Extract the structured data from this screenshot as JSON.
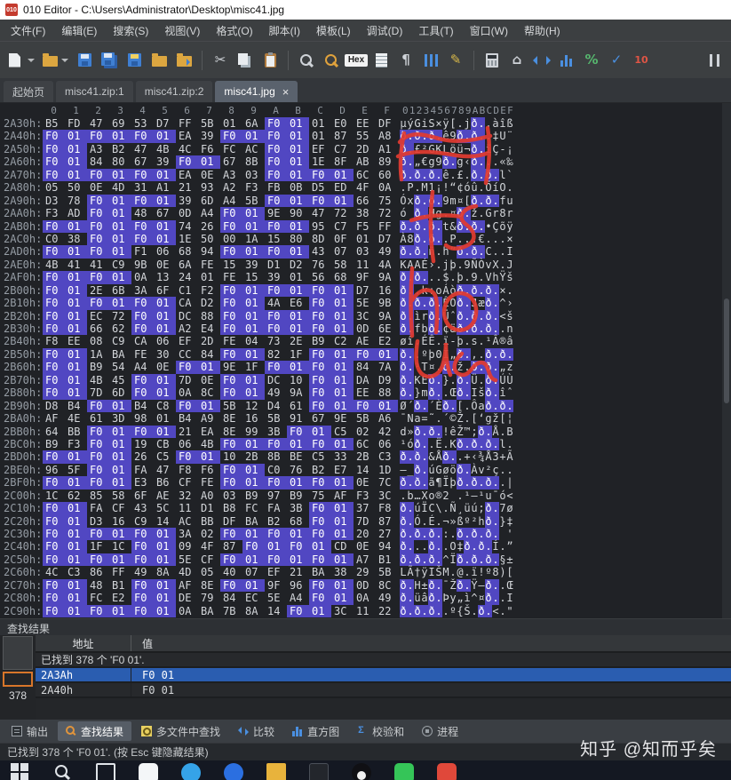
{
  "window": {
    "title": "010 Editor - C:\\Users\\Administrator\\Desktop\\misc41.jpg",
    "app_icon": "010-red-square"
  },
  "menu": {
    "items": [
      {
        "id": "file",
        "label": "文件(F)"
      },
      {
        "id": "edit",
        "label": "编辑(E)"
      },
      {
        "id": "search",
        "label": "搜索(S)"
      },
      {
        "id": "view",
        "label": "视图(V)"
      },
      {
        "id": "format",
        "label": "格式(O)"
      },
      {
        "id": "script",
        "label": "脚本(I)"
      },
      {
        "id": "template",
        "label": "模板(L)"
      },
      {
        "id": "debug",
        "label": "调试(D)"
      },
      {
        "id": "tools",
        "label": "工具(T)"
      },
      {
        "id": "window",
        "label": "窗口(W)"
      },
      {
        "id": "help",
        "label": "帮助(H)"
      }
    ]
  },
  "toolbar": {
    "buttons": [
      {
        "name": "new-file",
        "kind": "css",
        "css": "page",
        "caret": true
      },
      {
        "name": "open-file",
        "kind": "css",
        "css": "folder",
        "caret": true
      },
      {
        "name": "save",
        "kind": "css",
        "css": "floppy"
      },
      {
        "name": "save-all",
        "kind": "css",
        "css": "floppy2"
      },
      {
        "name": "save-as",
        "kind": "css",
        "css": "floppy3"
      },
      {
        "name": "close-file",
        "kind": "css",
        "css": "folder2"
      },
      {
        "name": "export-file",
        "kind": "css",
        "css": "folder3"
      },
      {
        "kind": "sep"
      },
      {
        "name": "cut",
        "kind": "glyph",
        "glyph": "✂",
        "color": "#cfd3d8"
      },
      {
        "name": "copy",
        "kind": "css",
        "css": "copy"
      },
      {
        "name": "paste",
        "kind": "css",
        "css": "clipboard"
      },
      {
        "kind": "sep"
      },
      {
        "name": "find",
        "kind": "css",
        "css": "magnifier"
      },
      {
        "name": "replace",
        "kind": "css",
        "css": "magnifier2"
      },
      {
        "name": "hex-view",
        "kind": "hexbox",
        "label": "Hex"
      },
      {
        "name": "text-view",
        "kind": "css",
        "css": "pagelines"
      },
      {
        "name": "show-whitespace",
        "kind": "glyph",
        "glyph": "¶",
        "color": "#cfd3d8"
      },
      {
        "name": "column-mode",
        "kind": "css",
        "css": "columns"
      },
      {
        "name": "run-script",
        "kind": "glyph",
        "glyph": "✎",
        "color": "#d8b84a"
      },
      {
        "kind": "sep"
      },
      {
        "name": "calculator",
        "kind": "css",
        "css": "calc"
      },
      {
        "name": "base-converter",
        "kind": "glyph",
        "glyph": "⌂",
        "color": "#cfd3d8"
      },
      {
        "name": "jump-arrows",
        "kind": "css",
        "css": "arrows"
      },
      {
        "name": "histogram",
        "kind": "css",
        "css": "bars"
      },
      {
        "name": "checksum",
        "kind": "glyph",
        "glyph": "%",
        "color": "#56b66e"
      },
      {
        "name": "validate",
        "kind": "glyph",
        "glyph": "✓",
        "color": "#4a8fe0"
      },
      {
        "name": "convert-base-10",
        "kind": "glyph",
        "glyph": "10",
        "color": "#e05545"
      },
      {
        "kind": "spacer"
      },
      {
        "name": "pause",
        "kind": "css",
        "css": "pause"
      }
    ]
  },
  "tabs": {
    "items": [
      {
        "id": "start-page",
        "label": "起始页",
        "active": false
      },
      {
        "id": "misc41-zip-1",
        "label": "misc41.zip:1",
        "active": false
      },
      {
        "id": "misc41-zip-2",
        "label": "misc41.zip:2",
        "active": false
      },
      {
        "id": "misc41-jpg",
        "label": "misc41.jpg",
        "active": true,
        "close": "×"
      }
    ]
  },
  "hex": {
    "byte_headers": [
      "0",
      "1",
      "2",
      "3",
      "4",
      "5",
      "6",
      "7",
      "8",
      "9",
      "A",
      "B",
      "C",
      "D",
      "E",
      "F"
    ],
    "ascii_header": "0123456789ABCDEF",
    "rows": [
      {
        "addr": "2A30h:",
        "bytes": [
          "B5",
          "FD",
          "47",
          "69",
          "53",
          "D7",
          "FF",
          "5B",
          "01",
          "6A",
          "F0",
          "01",
          "01",
          "E0",
          "EE",
          "DF"
        ]
      },
      {
        "addr": "2A40h:",
        "bytes": [
          "F0",
          "01",
          "F0",
          "01",
          "F0",
          "01",
          "EA",
          "39",
          "F0",
          "01",
          "F0",
          "01",
          "01",
          "87",
          "55",
          "A8"
        ]
      },
      {
        "addr": "2A50h:",
        "bytes": [
          "F0",
          "01",
          "A3",
          "B2",
          "47",
          "4B",
          "4C",
          "F6",
          "FC",
          "AC",
          "F0",
          "01",
          "EF",
          "C7",
          "2D",
          "A1"
        ]
      },
      {
        "addr": "2A60h:",
        "bytes": [
          "F0",
          "01",
          "84",
          "80",
          "67",
          "39",
          "F0",
          "01",
          "67",
          "8B",
          "F0",
          "01",
          "1E",
          "8F",
          "AB",
          "89"
        ]
      },
      {
        "addr": "2A70h:",
        "bytes": [
          "F0",
          "01",
          "F0",
          "01",
          "F0",
          "01",
          "EA",
          "0E",
          "A3",
          "03",
          "F0",
          "01",
          "F0",
          "01",
          "6C",
          "60"
        ]
      },
      {
        "addr": "2A80h:",
        "bytes": [
          "05",
          "50",
          "0E",
          "4D",
          "31",
          "A1",
          "21",
          "93",
          "A2",
          "F3",
          "FB",
          "0B",
          "D5",
          "ED",
          "4F",
          "0A"
        ]
      },
      {
        "addr": "2A90h:",
        "bytes": [
          "D3",
          "78",
          "F0",
          "01",
          "F0",
          "01",
          "39",
          "6D",
          "A4",
          "5B",
          "F0",
          "01",
          "F0",
          "01",
          "66",
          "75"
        ]
      },
      {
        "addr": "2AA0h:",
        "bytes": [
          "F3",
          "AD",
          "F0",
          "01",
          "48",
          "67",
          "0D",
          "A4",
          "F0",
          "01",
          "9E",
          "90",
          "47",
          "72",
          "38",
          "72"
        ]
      },
      {
        "addr": "2AB0h:",
        "bytes": [
          "F0",
          "01",
          "F0",
          "01",
          "F0",
          "01",
          "74",
          "26",
          "F0",
          "01",
          "F0",
          "01",
          "95",
          "C7",
          "F5",
          "FF"
        ]
      },
      {
        "addr": "2AC0h:",
        "bytes": [
          "C0",
          "38",
          "F0",
          "01",
          "F0",
          "01",
          "1E",
          "50",
          "00",
          "1A",
          "15",
          "80",
          "8D",
          "0F",
          "01",
          "D7"
        ]
      },
      {
        "addr": "2AD0h:",
        "bytes": [
          "F0",
          "01",
          "F0",
          "01",
          "F1",
          "06",
          "68",
          "94",
          "F0",
          "01",
          "F0",
          "01",
          "43",
          "07",
          "03",
          "49"
        ]
      },
      {
        "addr": "2AE0h:",
        "bytes": [
          "4B",
          "41",
          "41",
          "C9",
          "9B",
          "0E",
          "6A",
          "FE",
          "15",
          "39",
          "D1",
          "D2",
          "76",
          "58",
          "11",
          "4A"
        ]
      },
      {
        "addr": "2AF0h:",
        "bytes": [
          "F0",
          "01",
          "F0",
          "01",
          "0A",
          "13",
          "24",
          "01",
          "FE",
          "15",
          "39",
          "01",
          "56",
          "68",
          "9F",
          "9A"
        ]
      },
      {
        "addr": "2B00h:",
        "bytes": [
          "F0",
          "01",
          "2E",
          "6B",
          "3A",
          "6F",
          "C1",
          "F2",
          "F0",
          "01",
          "F0",
          "01",
          "F0",
          "01",
          "D7",
          "16"
        ]
      },
      {
        "addr": "2B10h:",
        "bytes": [
          "F0",
          "01",
          "F0",
          "01",
          "F0",
          "01",
          "CA",
          "D2",
          "F0",
          "01",
          "4A",
          "E6",
          "F0",
          "01",
          "5E",
          "9B"
        ]
      },
      {
        "addr": "2B20h:",
        "bytes": [
          "F0",
          "01",
          "EC",
          "72",
          "F0",
          "01",
          "DC",
          "88",
          "F0",
          "01",
          "F0",
          "01",
          "F0",
          "01",
          "3C",
          "9A"
        ]
      },
      {
        "addr": "2B30h:",
        "bytes": [
          "F0",
          "01",
          "66",
          "62",
          "F0",
          "01",
          "A2",
          "E4",
          "F0",
          "01",
          "F0",
          "01",
          "F0",
          "01",
          "0D",
          "6E"
        ]
      },
      {
        "addr": "2B40h:",
        "bytes": [
          "F8",
          "EE",
          "08",
          "C9",
          "CA",
          "06",
          "EF",
          "2D",
          "FE",
          "04",
          "73",
          "2E",
          "B9",
          "C2",
          "AE",
          "E2"
        ]
      },
      {
        "addr": "2B50h:",
        "bytes": [
          "F0",
          "01",
          "1A",
          "BA",
          "FE",
          "30",
          "CC",
          "84",
          "F0",
          "01",
          "82",
          "1F",
          "F0",
          "01",
          "F0",
          "01"
        ]
      },
      {
        "addr": "2B60h:",
        "bytes": [
          "F0",
          "01",
          "B9",
          "54",
          "A4",
          "0E",
          "F0",
          "01",
          "9E",
          "1F",
          "F0",
          "01",
          "F0",
          "01",
          "84",
          "7A"
        ]
      },
      {
        "addr": "2B70h:",
        "bytes": [
          "F0",
          "01",
          "4B",
          "45",
          "F0",
          "01",
          "7D",
          "0E",
          "F0",
          "01",
          "DC",
          "10",
          "F0",
          "01",
          "DA",
          "D9"
        ]
      },
      {
        "addr": "2B80h:",
        "bytes": [
          "F0",
          "01",
          "7D",
          "6D",
          "F0",
          "01",
          "0A",
          "8C",
          "F0",
          "01",
          "49",
          "9A",
          "F0",
          "01",
          "EE",
          "88"
        ]
      },
      {
        "addr": "2B90h:",
        "bytes": [
          "D8",
          "B4",
          "F0",
          "01",
          "B4",
          "C8",
          "F0",
          "01",
          "5B",
          "12",
          "D4",
          "61",
          "F0",
          "01",
          "F0",
          "01"
        ]
      },
      {
        "addr": "2BA0h:",
        "bytes": [
          "AF",
          "4E",
          "61",
          "3D",
          "98",
          "01",
          "B4",
          "A9",
          "8E",
          "16",
          "5B",
          "91",
          "67",
          "9E",
          "5B",
          "A6"
        ]
      },
      {
        "addr": "2BB0h:",
        "bytes": [
          "64",
          "BB",
          "F0",
          "01",
          "F0",
          "01",
          "21",
          "EA",
          "8E",
          "99",
          "3B",
          "F0",
          "01",
          "C5",
          "02",
          "42"
        ]
      },
      {
        "addr": "2BC0h:",
        "bytes": [
          "B9",
          "F3",
          "F0",
          "01",
          "19",
          "CB",
          "06",
          "4B",
          "F0",
          "01",
          "F0",
          "01",
          "F0",
          "01",
          "6C",
          "06"
        ]
      },
      {
        "addr": "2BD0h:",
        "bytes": [
          "F0",
          "01",
          "F0",
          "01",
          "26",
          "C5",
          "F0",
          "01",
          "10",
          "2B",
          "8B",
          "BE",
          "C5",
          "33",
          "2B",
          "C3"
        ]
      },
      {
        "addr": "2BE0h:",
        "bytes": [
          "96",
          "5F",
          "F0",
          "01",
          "FA",
          "47",
          "F8",
          "F6",
          "F0",
          "01",
          "C0",
          "76",
          "B2",
          "E7",
          "14",
          "1D"
        ]
      },
      {
        "addr": "2BF0h:",
        "bytes": [
          "F0",
          "01",
          "F0",
          "01",
          "E3",
          "B6",
          "CF",
          "FE",
          "F0",
          "01",
          "F0",
          "01",
          "F0",
          "01",
          "0E",
          "7C"
        ]
      },
      {
        "addr": "2C00h:",
        "bytes": [
          "1C",
          "62",
          "85",
          "58",
          "6F",
          "AE",
          "32",
          "A0",
          "03",
          "B9",
          "97",
          "B9",
          "75",
          "AF",
          "F3",
          "3C"
        ]
      },
      {
        "addr": "2C10h:",
        "bytes": [
          "F0",
          "01",
          "FA",
          "CF",
          "43",
          "5C",
          "11",
          "D1",
          "B8",
          "FC",
          "FA",
          "3B",
          "F0",
          "01",
          "37",
          "F8"
        ]
      },
      {
        "addr": "2C20h:",
        "bytes": [
          "F0",
          "01",
          "D3",
          "16",
          "C9",
          "14",
          "AC",
          "BB",
          "DF",
          "BA",
          "B2",
          "68",
          "F0",
          "01",
          "7D",
          "87"
        ]
      },
      {
        "addr": "2C30h:",
        "bytes": [
          "F0",
          "01",
          "F0",
          "01",
          "F0",
          "01",
          "3A",
          "02",
          "F0",
          "01",
          "F0",
          "01",
          "F0",
          "01",
          "20",
          "27"
        ]
      },
      {
        "addr": "2C40h:",
        "bytes": [
          "F0",
          "01",
          "1F",
          "1C",
          "F0",
          "01",
          "09",
          "4F",
          "87",
          "F0",
          "01",
          "F0",
          "01",
          "CD",
          "0E",
          "94"
        ]
      },
      {
        "addr": "2C50h:",
        "bytes": [
          "F0",
          "01",
          "F0",
          "01",
          "F0",
          "01",
          "5E",
          "CF",
          "F0",
          "01",
          "F0",
          "01",
          "F0",
          "01",
          "A7",
          "B1"
        ]
      },
      {
        "addr": "2C60h:",
        "bytes": [
          "4C",
          "C3",
          "86",
          "FF",
          "49",
          "8A",
          "4D",
          "05",
          "40",
          "07",
          "EF",
          "21",
          "BA",
          "38",
          "29",
          "5B"
        ]
      },
      {
        "addr": "2C70h:",
        "bytes": [
          "F0",
          "01",
          "48",
          "B1",
          "F0",
          "01",
          "AF",
          "8E",
          "F0",
          "01",
          "9F",
          "96",
          "F0",
          "01",
          "0D",
          "8C"
        ]
      },
      {
        "addr": "2C80h:",
        "bytes": [
          "F0",
          "01",
          "FC",
          "E2",
          "F0",
          "01",
          "DE",
          "79",
          "84",
          "EC",
          "5E",
          "A4",
          "F0",
          "01",
          "0A",
          "49"
        ]
      },
      {
        "addr": "2C90h:",
        "bytes": [
          "F0",
          "01",
          "F0",
          "01",
          "F0",
          "01",
          "0A",
          "BA",
          "7B",
          "8A",
          "14",
          "F0",
          "01",
          "3C",
          "11",
          "22"
        ]
      }
    ]
  },
  "find": {
    "panel_title": "查找结果",
    "columns": [
      "地址",
      "值"
    ],
    "summary": "已找到 378 个 'F0 01'.",
    "query": "F0 01",
    "results": [
      {
        "addr": "2A3Ah",
        "value": "F0 01",
        "selected": true
      },
      {
        "addr": "2A40h",
        "value": "F0 01",
        "selected": false
      }
    ],
    "count": "378"
  },
  "bottom_tabs": {
    "items": [
      {
        "id": "output",
        "label": "输出",
        "active": false
      },
      {
        "id": "find-results",
        "label": "查找结果",
        "active": true
      },
      {
        "id": "find-in-files",
        "label": "多文件中查找",
        "active": false
      },
      {
        "id": "compare",
        "label": "比较",
        "active": false
      },
      {
        "id": "histogram",
        "label": "直方图",
        "active": false
      },
      {
        "id": "checksum",
        "label": "校验和",
        "active": false
      },
      {
        "id": "processes",
        "label": "进程",
        "active": false
      }
    ]
  },
  "status": {
    "text": "已找到 378 个 'F0 01'. (按 Esc 键隐藏结果)"
  },
  "watermark": {
    "text": "知乎 @知而乎矣"
  },
  "taskbar": {
    "icons": [
      {
        "id": "start"
      },
      {
        "id": "search"
      },
      {
        "id": "task-view"
      },
      {
        "id": "app-chat"
      },
      {
        "id": "app-edge"
      },
      {
        "id": "app-browser"
      },
      {
        "id": "app-folder"
      },
      {
        "id": "app-code"
      },
      {
        "id": "app-qq"
      },
      {
        "id": "app-green"
      },
      {
        "id": "app-red"
      }
    ]
  }
}
